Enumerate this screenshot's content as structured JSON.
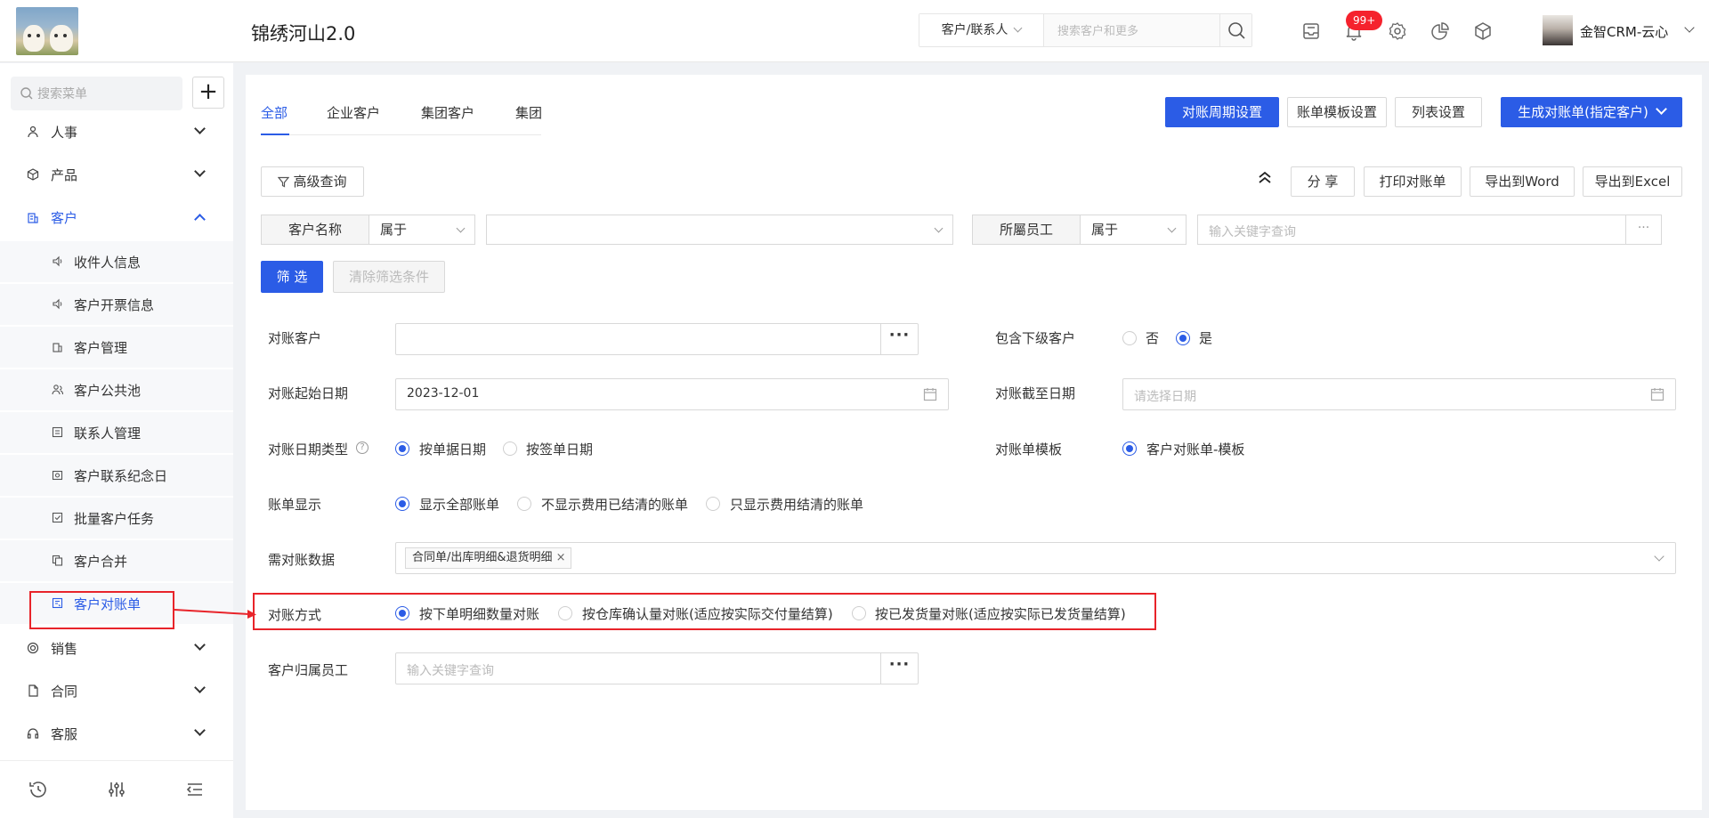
{
  "header": {
    "app_title": "锦绣河山2.0",
    "search_type": "客户/联系人",
    "search_placeholder": "搜索客户和更多",
    "notification_count": "99+",
    "user_name": "金智CRM-云心"
  },
  "sidebar": {
    "search_placeholder": "搜索菜单",
    "plus": "+",
    "items": [
      {
        "label": "人事"
      },
      {
        "label": "产品"
      },
      {
        "label": "客户"
      },
      {
        "label": "销售"
      },
      {
        "label": "合同"
      },
      {
        "label": "客服"
      }
    ],
    "sub_items": [
      {
        "label": "收件人信息"
      },
      {
        "label": "客户开票信息"
      },
      {
        "label": "客户管理"
      },
      {
        "label": "客户公共池"
      },
      {
        "label": "联系人管理"
      },
      {
        "label": "客户联系纪念日"
      },
      {
        "label": "批量客户任务"
      },
      {
        "label": "客户合并"
      },
      {
        "label": "客户对账单"
      }
    ]
  },
  "tabs": [
    "全部",
    "企业客户",
    "集团客户",
    "集团"
  ],
  "toolbar": {
    "cycle_settings": "对账周期设置",
    "template_settings": "账单模板设置",
    "list_settings": "列表设置",
    "generate": "生成对账单(指定客户)",
    "advanced_query": "高级查询",
    "share": "分 享",
    "print": "打印对账单",
    "export_word": "导出到Word",
    "export_excel": "导出到Excel"
  },
  "filters": {
    "customer_name_label": "客户名称",
    "customer_name_op": "属于",
    "employee_label": "所屬员工",
    "employee_op": "属于",
    "employee_placeholder": "输入关键字查询",
    "employee_more": "···",
    "filter_btn": "筛 选",
    "clear_btn": "清除筛选条件"
  },
  "form": {
    "recon_customer_label": "对账客户",
    "include_sub_label": "包含下级客户",
    "include_sub_options": [
      "否",
      "是"
    ],
    "start_date_label": "对账起始日期",
    "start_date_value": "2023-12-01",
    "end_date_label": "对账截至日期",
    "end_date_placeholder": "请选择日期",
    "date_type_label": "对账日期类型",
    "date_type_options": [
      "按单据日期",
      "按签单日期"
    ],
    "template_label": "对账单模板",
    "template_option": "客户对账单-模板",
    "bill_display_label": "账单显示",
    "bill_display_options": [
      "显示全部账单",
      "不显示费用已结清的账单",
      "只显示费用结清的账单"
    ],
    "data_label": "需对账数据",
    "data_tag": "合同单/出库明细&退货明细",
    "method_label": "对账方式",
    "method_options": [
      "按下单明细数量对账",
      "按仓库确认量对账(适应按实际交付量结算)",
      "按已发货量对账(适应按实际已发货量结算)"
    ],
    "owner_label": "客户归属员工",
    "owner_placeholder": "输入关键字查询"
  },
  "colors": {
    "primary": "#2b5ce6",
    "annotation_red": "#e8242a"
  }
}
